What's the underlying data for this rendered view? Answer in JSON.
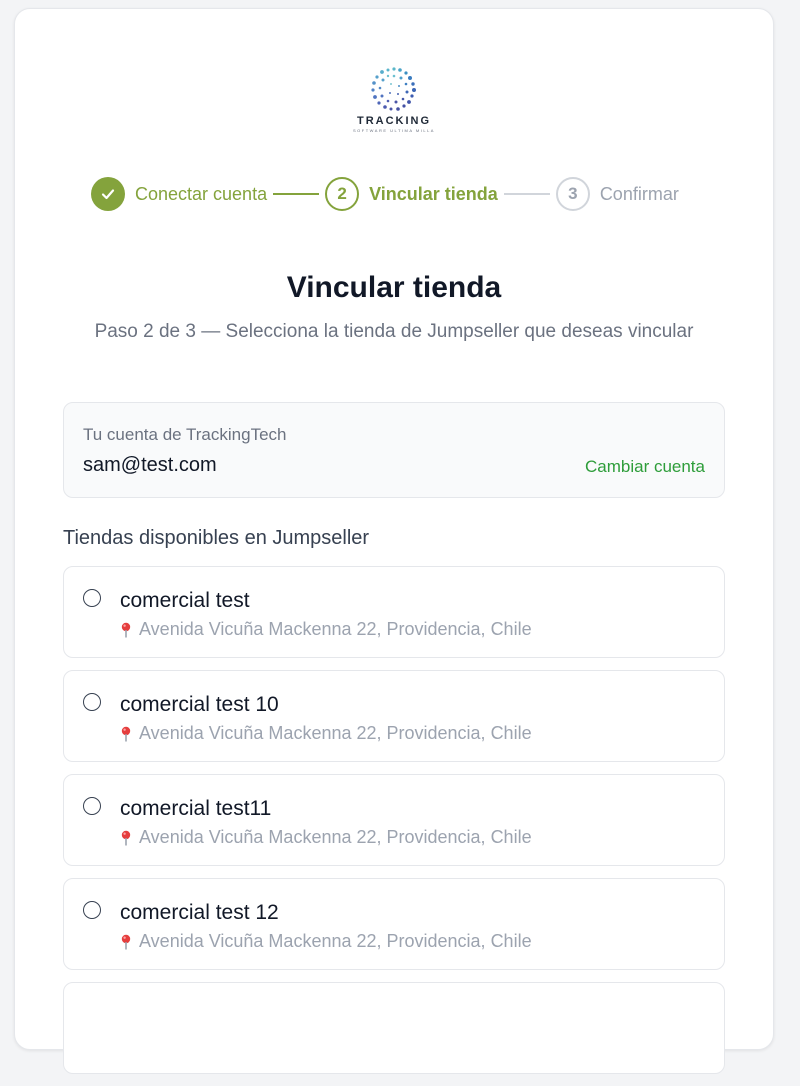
{
  "brand": {
    "name": "TRACKING",
    "tagline": "SOFTWARE ULTIMA MILLA",
    "logo_icon": "dotted-circle-logo-icon",
    "accent": "#84a33c"
  },
  "stepper": {
    "steps": [
      {
        "number": "",
        "label": "Conectar cuenta",
        "state": "done",
        "icon": "check-icon"
      },
      {
        "number": "2",
        "label": "Vincular tienda",
        "state": "active"
      },
      {
        "number": "3",
        "label": "Confirmar",
        "state": "todo"
      }
    ]
  },
  "header": {
    "title": "Vincular tienda",
    "subtitle": "Paso 2 de 3 — Selecciona la tienda de Jumpseller que deseas vincular"
  },
  "account": {
    "label": "Tu cuenta de TrackingTech",
    "email": "sam@test.com",
    "change_label": "Cambiar cuenta",
    "change_color": "#2e9d3a"
  },
  "stores_section": {
    "title": "Tiendas disponibles en Jumpseller",
    "address_icon": "map-pin-icon",
    "items": [
      {
        "name": "comercial test",
        "address": "Avenida Vicuña Mackenna 22, Providencia, Chile"
      },
      {
        "name": "comercial test 10",
        "address": "Avenida Vicuña Mackenna 22, Providencia, Chile"
      },
      {
        "name": "comercial test11",
        "address": "Avenida Vicuña Mackenna 22, Providencia, Chile"
      },
      {
        "name": "comercial test 12",
        "address": "Avenida Vicuña Mackenna 22, Providencia, Chile"
      }
    ]
  }
}
